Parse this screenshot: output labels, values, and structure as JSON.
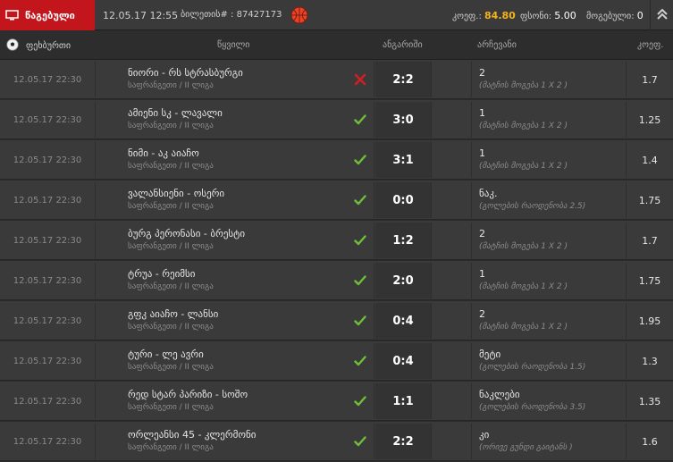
{
  "topbar": {
    "status_label": "წაგებული",
    "datetime": "12.05.17 12:55",
    "ticket_label": "ბილეთის# : 87427173",
    "odds_label": "კოეფ.:",
    "odds_value": "84.80",
    "stake_label": "ფსონი:",
    "stake_value": "5.00",
    "win_label": "მოგებული:",
    "win_value": "0",
    "status_color": "#c3161c",
    "accent_color": "#f5b31b",
    "icons": [
      "monitor-icon",
      "basketball-icon",
      "double-chevron-up-icon"
    ]
  },
  "header": {
    "sport_label": "ფეხბურთი",
    "sport_icon": "soccer-ball-icon",
    "col_match": "წყვილი",
    "col_score": "ანგარიში",
    "col_pick": "არჩევანი",
    "col_odds": "კოეფ."
  },
  "bets": [
    {
      "date": "12.05.17 22:30",
      "teams": "ნიორი - რს სტრასბურგი",
      "league": "საფრანგეთი / II ლიგა",
      "result": "lost",
      "score": "2:2",
      "pick": "2",
      "market": "(მატჩის მოგება 1 X 2 )",
      "odds": "1.7"
    },
    {
      "date": "12.05.17 22:30",
      "teams": "ამიენი სკ - ლავალი",
      "league": "საფრანგეთი / II ლიგა",
      "result": "won",
      "score": "3:0",
      "pick": "1",
      "market": "(მატჩის მოგება 1 X 2 )",
      "odds": "1.25"
    },
    {
      "date": "12.05.17 22:30",
      "teams": "ნიმი - აკ აიაჩო",
      "league": "საფრანგეთი / II ლიგა",
      "result": "won",
      "score": "3:1",
      "pick": "1",
      "market": "(მატჩის მოგება 1 X 2 )",
      "odds": "1.4"
    },
    {
      "date": "12.05.17 22:30",
      "teams": "ვალანსიენი - ოსერი",
      "league": "საფრანგეთი / II ლიგა",
      "result": "won",
      "score": "0:0",
      "pick": "ნაკ.",
      "market": "(გოლების რაოდენობა 2.5)",
      "odds": "1.75"
    },
    {
      "date": "12.05.17 22:30",
      "teams": "ბურგ პერონასი - ბრესტი",
      "league": "საფრანგეთი / II ლიგა",
      "result": "won",
      "score": "1:2",
      "pick": "2",
      "market": "(მატჩის მოგება 1 X 2 )",
      "odds": "1.7"
    },
    {
      "date": "12.05.17 22:30",
      "teams": "ტრუა - რეიმსი",
      "league": "საფრანგეთი / II ლიგა",
      "result": "won",
      "score": "2:0",
      "pick": "1",
      "market": "(მატჩის მოგება 1 X 2 )",
      "odds": "1.75"
    },
    {
      "date": "12.05.17 22:30",
      "teams": "გფკ აიაჩო - ლანსი",
      "league": "საფრანგეთი / II ლიგა",
      "result": "won",
      "score": "0:4",
      "pick": "2",
      "market": "(მატჩის მოგება 1 X 2 )",
      "odds": "1.95"
    },
    {
      "date": "12.05.17 22:30",
      "teams": "ტური - ლე ავრი",
      "league": "საფრანგეთი / II ლიგა",
      "result": "won",
      "score": "0:4",
      "pick": "მეტი",
      "market": "(გოლების რაოდენობა 1.5)",
      "odds": "1.3"
    },
    {
      "date": "12.05.17 22:30",
      "teams": "რედ სტარ პარიზი - სოშო",
      "league": "საფრანგეთი / II ლიგა",
      "result": "won",
      "score": "1:1",
      "pick": "ნაკლები",
      "market": "(გოლების რაოდენობა 3.5)",
      "odds": "1.35"
    },
    {
      "date": "12.05.17 22:30",
      "teams": "ორლეანსი 45 - კლერმონი",
      "league": "საფრანგეთი / II ლიგა",
      "result": "won",
      "score": "2:2",
      "pick": "კი",
      "market": "(ორივე გუნდი გაიტანს )",
      "odds": "1.6"
    }
  ],
  "colors": {
    "won": "#6fbf3a",
    "lost": "#d01f24"
  }
}
